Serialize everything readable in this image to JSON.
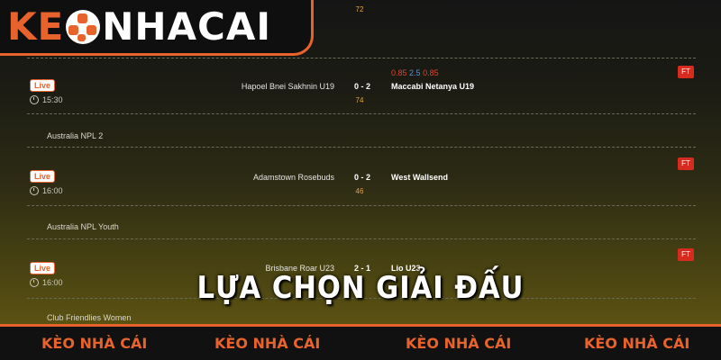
{
  "logo": {
    "part1": "K",
    "part2": "E",
    "part3": "NHACAI"
  },
  "top_minute": "72",
  "matches": [
    {
      "status": "Live",
      "time": "15:30",
      "home": "Hapoel Bnei Sakhnin U19",
      "score": "0 - 2",
      "away": "Maccabi Netanya U19",
      "minute": "74",
      "odds": [
        "0.85",
        "2.5",
        "0.85"
      ],
      "result": "FT"
    },
    {
      "league": "Australia NPL 2",
      "status": "Live",
      "time": "16:00",
      "home": "Adamstown Rosebuds",
      "score": "0 - 2",
      "away": "West Wallsend",
      "minute": "46",
      "result": "FT"
    },
    {
      "league": "Australia NPL Youth",
      "status": "Live",
      "time": "16:00",
      "home": "Brisbane Roar U23",
      "score": "2 - 1",
      "away": "Lio    U23",
      "result": "FT"
    }
  ],
  "next_league": "Club Friendlies Women",
  "headline": "LỰA CHỌN GIẢI ĐẤU",
  "footer": [
    "KÈO NHÀ CÁI",
    "KÈO NHÀ CÁI",
    "KÈO NHÀ CÁI",
    "KÈO NHÀ CÁI"
  ],
  "colors": {
    "accent": "#e8632b",
    "ft_badge": "#d72b1f",
    "minute": "#e8a23b"
  }
}
